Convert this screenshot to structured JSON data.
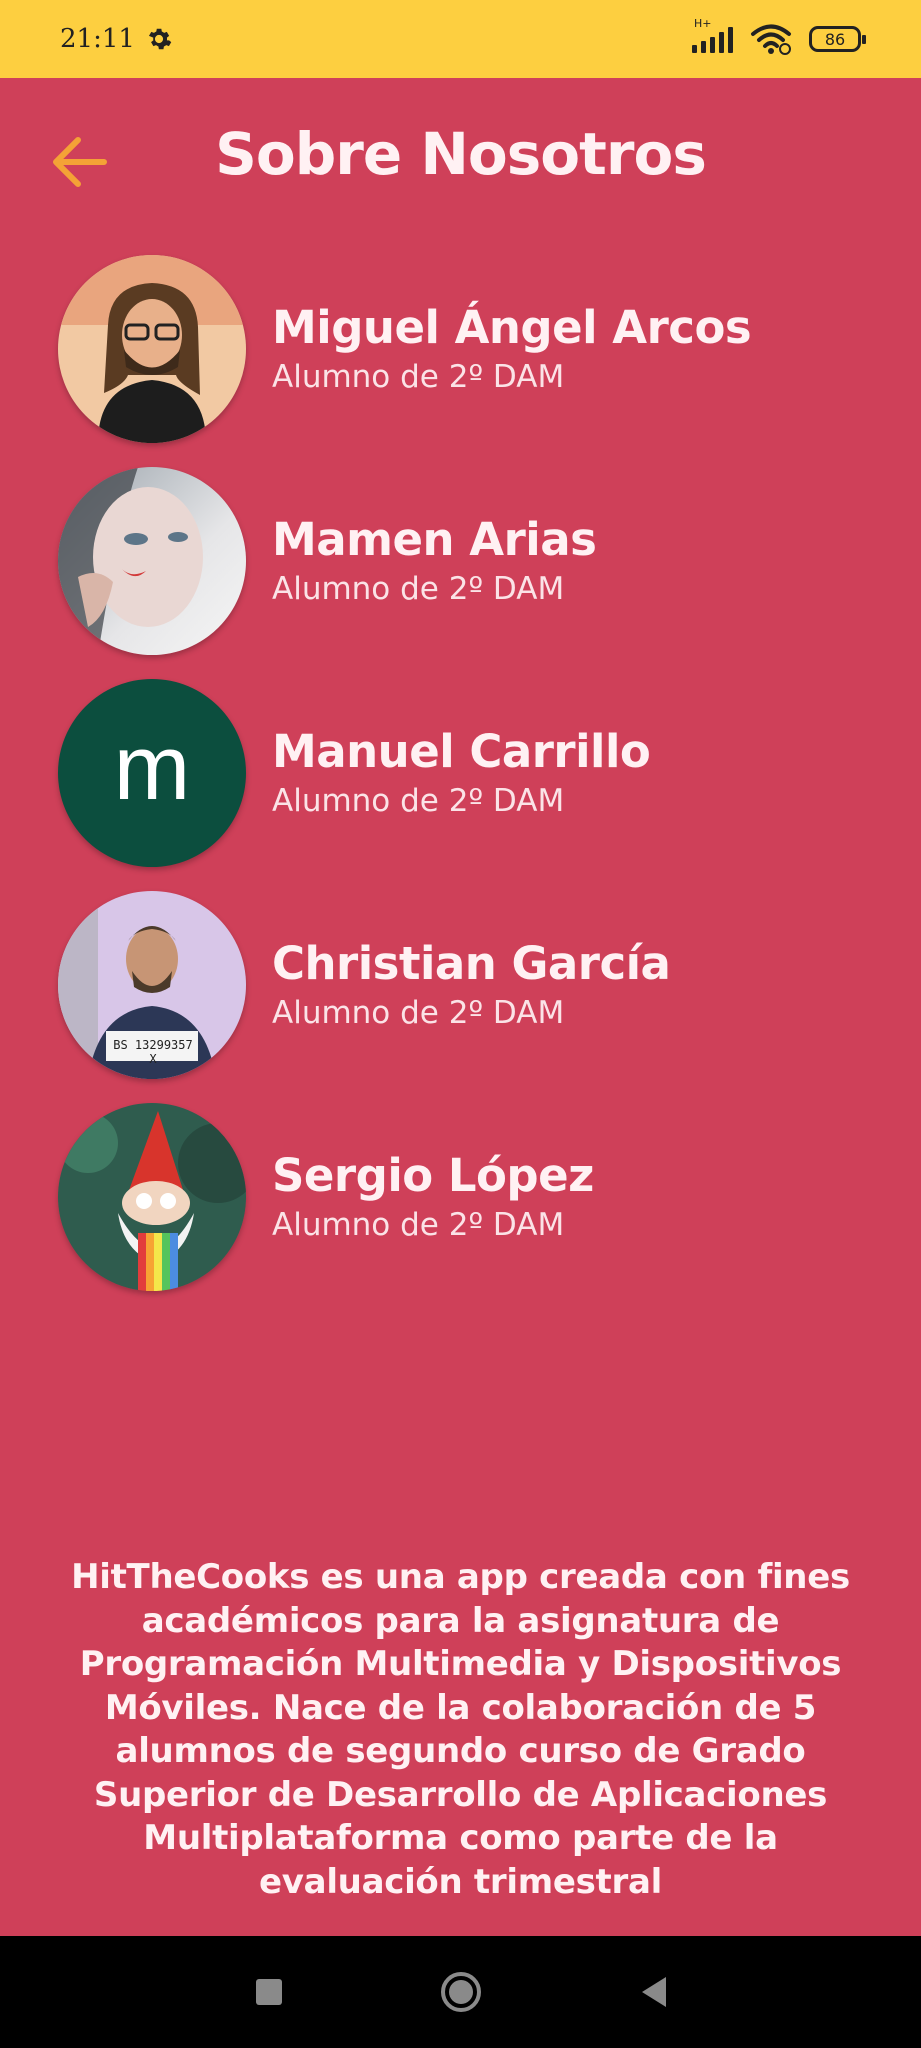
{
  "status_bar": {
    "time": "21:11",
    "network": "H+",
    "battery": "86"
  },
  "header": {
    "title": "Sobre Nosotros"
  },
  "members": [
    {
      "name": "Miguel Ángel Arcos",
      "role": "Alumno de 2º DAM"
    },
    {
      "name": "Mamen Arias",
      "role": "Alumno de 2º DAM"
    },
    {
      "name": "Manuel Carrillo",
      "role": "Alumno de 2º DAM",
      "avatar_letter": "m"
    },
    {
      "name": "Christian García",
      "role": "Alumno de 2º DAM",
      "sign_text": "BS 13299357 X"
    },
    {
      "name": "Sergio López",
      "role": "Alumno de 2º DAM"
    }
  ],
  "about": {
    "text": "HitTheCooks es una app creada con fines académicos para la asignatura de Programación Multimedia y Dispositivos Móviles. Nace de la colaboración de 5 alumnos de segundo curso de Grado Superior de Desarrollo de Aplicaciones Multiplataforma como parte de la evaluación trimestral"
  },
  "colors": {
    "background": "#CF4059",
    "status_bar": "#FDCF40",
    "back_arrow": "#F4A236",
    "text": "#FFF1F3",
    "avatar_manuel": "#0C4E3E"
  }
}
